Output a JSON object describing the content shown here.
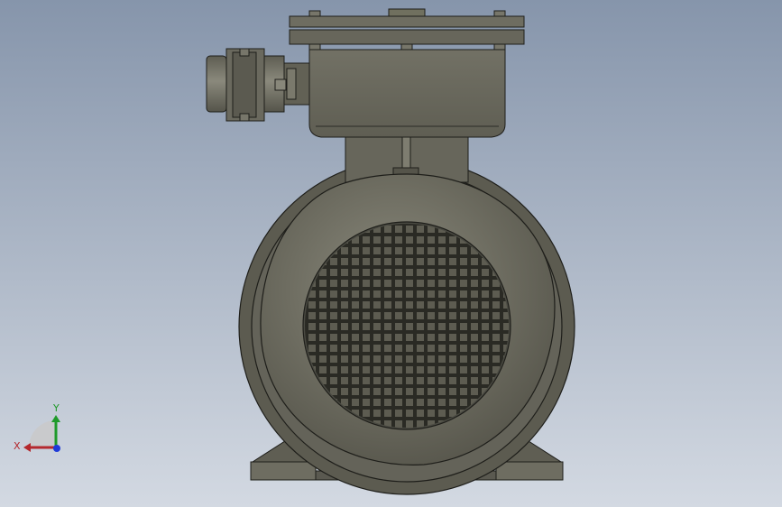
{
  "viewport": {
    "background_top": "#8695ab",
    "background_bottom": "#d3d9e2",
    "model_fill": "#6b6a5e",
    "edge_color": "#1e1e1a"
  },
  "triad": {
    "x_label": "X",
    "y_label": "Y",
    "x_color": "#b4282d",
    "y_color": "#1f9a2a",
    "z_color": "#1f3bd8"
  }
}
